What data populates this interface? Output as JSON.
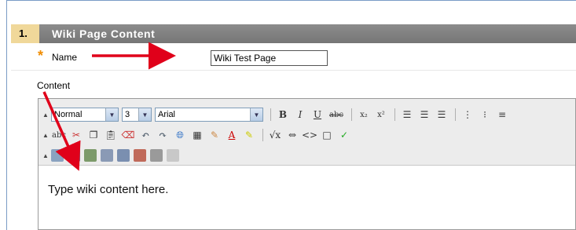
{
  "section": {
    "number": "1.",
    "title": "Wiki Page Content"
  },
  "name_field": {
    "required_mark": "*",
    "label": "Name",
    "value": "Wiki Test Page"
  },
  "content_field": {
    "label": "Content",
    "body_text": "Type wiki content here."
  },
  "toolbar": {
    "row1": {
      "format_select": "Normal",
      "size_select": "3",
      "font_select": "Arial",
      "bold": "B",
      "italic": "I",
      "underline": "U",
      "strike": "abc",
      "subscript": "x₂",
      "superscript": "x²"
    },
    "row2": {
      "spellcheck": "abc"
    }
  },
  "colors": {
    "accent": "#f0d89a",
    "header_bg": "#808080",
    "arrow": "#e0001a",
    "required": "#f08c00"
  }
}
